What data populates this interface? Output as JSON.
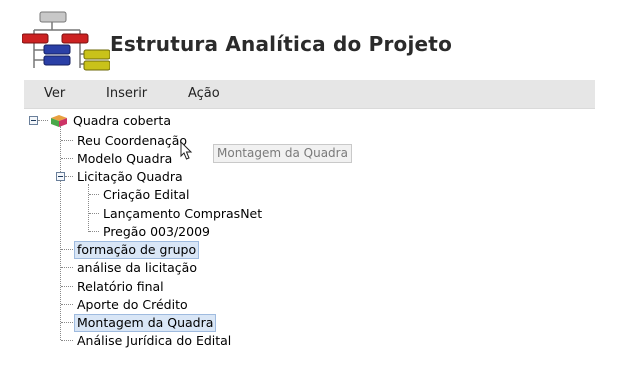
{
  "header": {
    "title": "Estrutura Analítica do Projeto",
    "logo_icon": "wbs-hierarchy-icon"
  },
  "menu": {
    "items": [
      {
        "label": "Ver"
      },
      {
        "label": "Inserir"
      },
      {
        "label": "Ação"
      }
    ]
  },
  "tree": {
    "root": {
      "label": "Quadra coberta",
      "icon": "cube-icon",
      "expanded": true
    },
    "nodes": [
      {
        "label": "Reu Coordenação"
      },
      {
        "label": "Modelo Quadra"
      },
      {
        "label": "Licitação Quadra",
        "expanded": true
      },
      {
        "label": "Criação Edital"
      },
      {
        "label": "Lançamento ComprasNet"
      },
      {
        "label": "Pregão 003/2009"
      },
      {
        "label": "formação de grupo",
        "selected": true
      },
      {
        "label": "análise da licitação"
      },
      {
        "label": "Relatório final"
      },
      {
        "label": "Aporte do Crédito"
      },
      {
        "label": "Montagem da Quadra",
        "selected": true
      },
      {
        "label": "Análise Jurídica do Edital"
      }
    ]
  },
  "drag_tooltip": {
    "label": "Montagem da Quadra"
  },
  "colors": {
    "menubar_bg": "#e6e6e6",
    "selection_bg": "#d9e6f6",
    "selection_border": "#9fbbdf",
    "logo_red": "#cc2222",
    "logo_blue": "#2a3fa6",
    "logo_yellow": "#c9c21a"
  }
}
